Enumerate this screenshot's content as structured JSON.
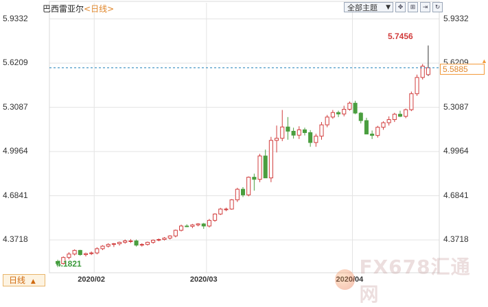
{
  "header": {
    "symbol": "巴西雷亚尔",
    "period_label": "<日线>",
    "theme_select": "全部主题",
    "buttons": [
      "fullscreen-icon",
      "zoom-in-icon",
      "go-end-icon",
      "refresh-icon"
    ]
  },
  "period_tab": {
    "label": "日线",
    "arrow": "▲"
  },
  "last_price": {
    "value": "5.5885",
    "color": "#f39a3a"
  },
  "annotations": {
    "high": "5.7456",
    "low": "4.1821"
  },
  "watermark": "FX678汇通网",
  "chart_data": {
    "type": "candlestick",
    "colors": {
      "up": "#d13b3b",
      "down": "#4a9e3f",
      "grid": "#e3e3e3"
    },
    "ylim": [
      4.14,
      5.98
    ],
    "yticks": [
      "5.9332",
      "5.6209",
      "5.3087",
      "4.9964",
      "4.6841",
      "4.3718"
    ],
    "xticks": [
      {
        "label": "2020/02",
        "index": 7
      },
      {
        "label": "2020/03",
        "index": 27
      },
      {
        "label": "2020/04",
        "index": 53
      }
    ],
    "candles": [
      [
        4.22,
        4.232,
        4.18,
        4.205
      ],
      [
        4.205,
        4.255,
        4.198,
        4.248
      ],
      [
        4.248,
        4.285,
        4.235,
        4.272
      ],
      [
        4.272,
        4.305,
        4.262,
        4.298
      ],
      [
        4.298,
        4.302,
        4.26,
        4.268
      ],
      [
        4.268,
        4.282,
        4.255,
        4.275
      ],
      [
        4.275,
        4.29,
        4.265,
        4.28
      ],
      [
        4.28,
        4.32,
        4.27,
        4.31
      ],
      [
        4.31,
        4.335,
        4.3,
        4.328
      ],
      [
        4.328,
        4.348,
        4.318,
        4.34
      ],
      [
        4.34,
        4.35,
        4.322,
        4.345
      ],
      [
        4.345,
        4.36,
        4.332,
        4.355
      ],
      [
        4.355,
        4.375,
        4.345,
        4.365
      ],
      [
        4.365,
        4.378,
        4.35,
        4.365
      ],
      [
        4.365,
        4.375,
        4.325,
        4.335
      ],
      [
        4.335,
        4.348,
        4.325,
        4.34
      ],
      [
        4.34,
        4.36,
        4.332,
        4.355
      ],
      [
        4.355,
        4.375,
        4.345,
        4.37
      ],
      [
        4.37,
        4.382,
        4.362,
        4.375
      ],
      [
        4.375,
        4.392,
        4.368,
        4.385
      ],
      [
        4.385,
        4.405,
        4.375,
        4.4
      ],
      [
        4.4,
        4.445,
        4.39,
        4.44
      ],
      [
        4.44,
        4.48,
        4.432,
        4.47
      ],
      [
        4.47,
        4.482,
        4.462,
        4.468
      ],
      [
        4.468,
        4.485,
        4.455,
        4.478
      ],
      [
        4.478,
        4.49,
        4.468,
        4.485
      ],
      [
        4.485,
        4.492,
        4.45,
        4.47
      ],
      [
        4.47,
        4.52,
        4.46,
        4.51
      ],
      [
        4.51,
        4.56,
        4.5,
        4.555
      ],
      [
        4.555,
        4.598,
        4.548,
        4.59
      ],
      [
        4.59,
        4.6,
        4.575,
        4.59
      ],
      [
        4.59,
        4.66,
        4.585,
        4.655
      ],
      [
        4.655,
        4.74,
        4.64,
        4.73
      ],
      [
        4.73,
        4.745,
        4.675,
        4.69
      ],
      [
        4.69,
        4.82,
        4.68,
        4.815
      ],
      [
        4.815,
        4.84,
        4.72,
        4.8
      ],
      [
        4.8,
        4.98,
        4.78,
        4.965
      ],
      [
        4.965,
        5.01,
        4.88,
        4.81
      ],
      [
        4.81,
        5.1,
        4.78,
        5.075
      ],
      [
        5.075,
        5.18,
        4.99,
        5.09
      ],
      [
        5.09,
        5.29,
        5.07,
        5.17
      ],
      [
        5.17,
        5.24,
        5.08,
        5.14
      ],
      [
        5.14,
        5.165,
        5.088,
        5.112
      ],
      [
        5.112,
        5.175,
        5.085,
        5.15
      ],
      [
        5.15,
        5.165,
        5.11,
        5.13
      ],
      [
        5.13,
        5.148,
        5.03,
        5.06
      ],
      [
        5.06,
        5.122,
        5.03,
        5.105
      ],
      [
        5.105,
        5.205,
        5.08,
        5.185
      ],
      [
        5.185,
        5.255,
        5.168,
        5.24
      ],
      [
        5.24,
        5.29,
        5.228,
        5.272
      ],
      [
        5.272,
        5.285,
        5.24,
        5.262
      ],
      [
        5.262,
        5.32,
        5.245,
        5.295
      ],
      [
        5.295,
        5.35,
        5.285,
        5.338
      ],
      [
        5.338,
        5.355,
        5.26,
        5.268
      ],
      [
        5.268,
        5.275,
        5.195,
        5.215
      ],
      [
        5.215,
        5.235,
        5.12,
        5.12
      ],
      [
        5.12,
        5.145,
        5.085,
        5.11
      ],
      [
        5.11,
        5.178,
        5.095,
        5.168
      ],
      [
        5.168,
        5.21,
        5.15,
        5.2
      ],
      [
        5.2,
        5.245,
        5.18,
        5.222
      ],
      [
        5.222,
        5.27,
        5.205,
        5.26
      ],
      [
        5.26,
        5.285,
        5.24,
        5.245
      ],
      [
        5.245,
        5.3,
        5.232,
        5.292
      ],
      [
        5.292,
        5.42,
        5.282,
        5.405
      ],
      [
        5.405,
        5.54,
        5.39,
        5.52
      ],
      [
        5.52,
        5.615,
        5.505,
        5.6
      ],
      [
        5.54,
        5.7456,
        5.53,
        5.5885
      ]
    ]
  }
}
